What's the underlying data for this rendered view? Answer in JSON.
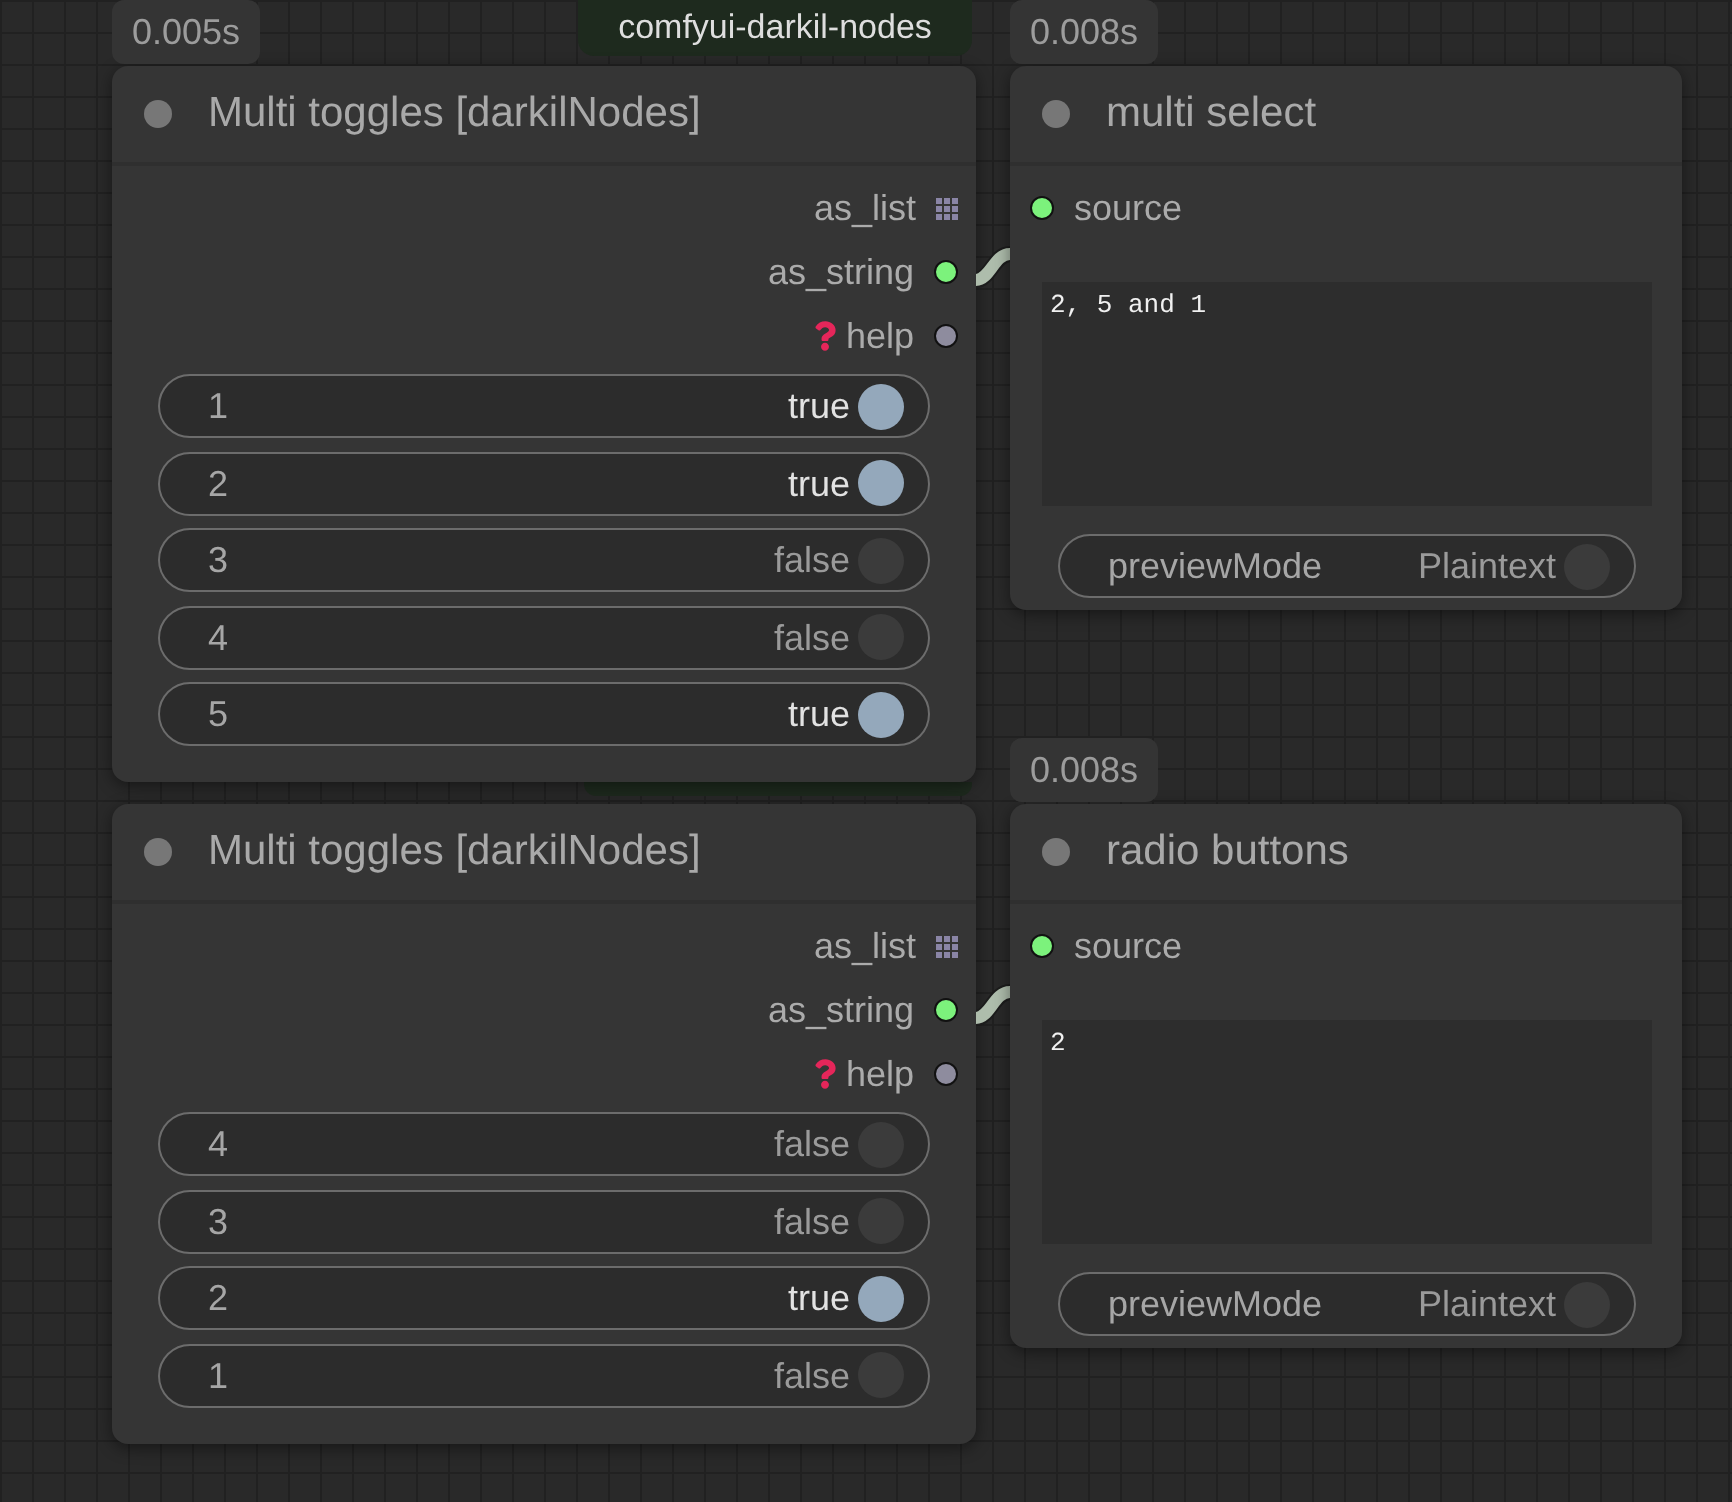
{
  "group": {
    "title": "comfyui-darkil-nodes"
  },
  "nodes": [
    {
      "kind": "toggles",
      "timing": "0.005s",
      "title": "Multi toggles [darkilNodes]",
      "outputs": [
        {
          "label": "as_list",
          "kind": "list",
          "color": "#8a85a6",
          "linked": false
        },
        {
          "label": "as_string",
          "kind": "value",
          "color": "#7cf27c",
          "linked": true
        },
        {
          "label": "help",
          "kind": "help",
          "color": "#8e8c9e",
          "linked": false
        }
      ],
      "toggles": [
        {
          "label": "1",
          "value": "true",
          "on": true
        },
        {
          "label": "2",
          "value": "true",
          "on": true
        },
        {
          "label": "3",
          "value": "false",
          "on": false
        },
        {
          "label": "4",
          "value": "false",
          "on": false
        },
        {
          "label": "5",
          "value": "true",
          "on": true
        }
      ]
    },
    {
      "kind": "toggles",
      "title": "Multi toggles [darkilNodes]",
      "outputs": [
        {
          "label": "as_list",
          "kind": "list",
          "color": "#8a85a6",
          "linked": false
        },
        {
          "label": "as_string",
          "kind": "value",
          "color": "#7cf27c",
          "linked": true
        },
        {
          "label": "help",
          "kind": "help",
          "color": "#8e8c9e",
          "linked": false
        }
      ],
      "toggles": [
        {
          "label": "4",
          "value": "false",
          "on": false
        },
        {
          "label": "3",
          "value": "false",
          "on": false
        },
        {
          "label": "2",
          "value": "true",
          "on": true
        },
        {
          "label": "1",
          "value": "false",
          "on": false
        }
      ]
    },
    {
      "kind": "preview",
      "timing": "0.008s",
      "title": "multi select",
      "inputs": [
        {
          "label": "source"
        }
      ],
      "text": "2, 5 and 1",
      "widgets": [
        {
          "label": "previewMode",
          "value": "Plaintext",
          "on": false
        }
      ]
    },
    {
      "kind": "preview",
      "timing": "0.008s",
      "title": "radio buttons",
      "inputs": [
        {
          "label": "source"
        }
      ],
      "text": "2",
      "widgets": [
        {
          "label": "previewMode",
          "value": "Plaintext",
          "on": false
        }
      ]
    }
  ]
}
